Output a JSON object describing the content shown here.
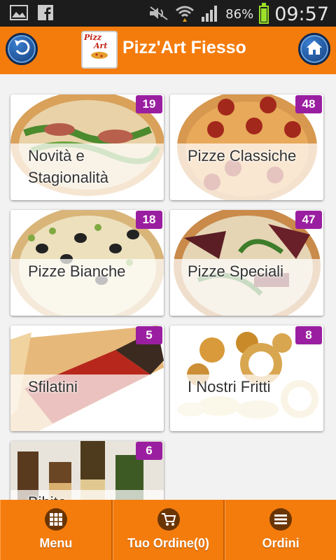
{
  "status_bar": {
    "battery_percent": "86%",
    "battery_level": 0.86,
    "time": "09:57",
    "icons": [
      "gallery-icon",
      "facebook-icon",
      "mute-icon",
      "wifi-icon",
      "signal-icon",
      "battery-icon"
    ]
  },
  "header": {
    "title": "Pizz'Art Fiesso",
    "logo_text_1": "Pizz",
    "logo_text_2": "Art",
    "back_icon": "back-arrow-icon",
    "home_icon": "home-icon",
    "color": "#f47c0c"
  },
  "categories": [
    {
      "label": "Novità e Stagionalità",
      "count": "19",
      "image": "pizza-arugula"
    },
    {
      "label": "Pizze Classiche",
      "count": "48",
      "image": "pizza-pepperoni"
    },
    {
      "label": "Pizze Bianche",
      "count": "18",
      "image": "pizza-olives"
    },
    {
      "label": "Pizze Speciali",
      "count": "47",
      "image": "pizza-special"
    },
    {
      "label": "Sfilatini",
      "count": "5",
      "image": "sfilatino-roll"
    },
    {
      "label": "I Nostri Fritti",
      "count": "8",
      "image": "fried-food"
    },
    {
      "label": "Bibite",
      "count": "6",
      "image": "beer-bottles"
    }
  ],
  "tabbar": {
    "menu_label": "Menu",
    "order_label": "Tuo Ordine(0)",
    "orders_label": "Ordini"
  },
  "colors": {
    "accent": "#f47c0c",
    "badge": "#9a1fa0",
    "button_blue": "#1f5aa6"
  }
}
